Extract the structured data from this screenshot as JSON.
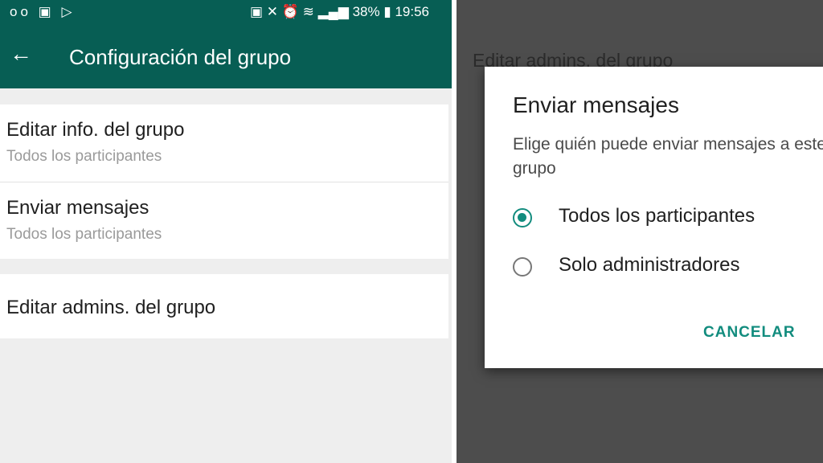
{
  "status_bar": {
    "left_icons": [
      "voicemail-icon",
      "image-icon",
      "play-store-icon"
    ],
    "right_icons": [
      "nfc-icon",
      "mute-icon",
      "alarm-icon",
      "wifi-icon",
      "signal-icon"
    ],
    "battery": "38%",
    "time": "19:56"
  },
  "app_bar": {
    "title": "Configuración del grupo",
    "back_icon": "arrow-left-icon"
  },
  "settings": {
    "items": [
      {
        "title": "Editar info. del grupo",
        "subtitle": "Todos los participantes"
      },
      {
        "title": "Enviar mensajes",
        "subtitle": "Todos los participantes"
      },
      {
        "title": "Editar admins. del grupo"
      }
    ]
  },
  "background_item": "Editar admins. del grupo",
  "dialog": {
    "title": "Enviar mensajes",
    "message": "Elige quién puede enviar mensajes a este grupo",
    "options": [
      {
        "label": "Todos los participantes",
        "selected": true
      },
      {
        "label": "Solo administradores",
        "selected": false
      }
    ],
    "cancel_label": "CANCELAR"
  },
  "colors": {
    "header": "#075e54",
    "accent": "#128c7e",
    "overlay": "#4d4d4d"
  }
}
